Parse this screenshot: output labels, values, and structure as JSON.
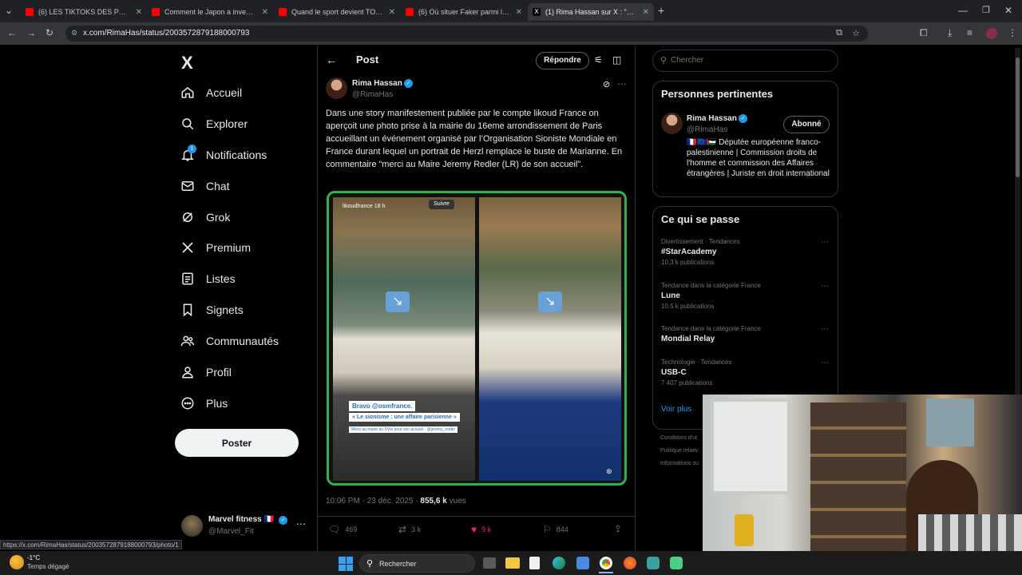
{
  "browser": {
    "tabs": [
      {
        "title": "(6) LES TIKTOKS DES POLITIQUES",
        "color": "#ff0000",
        "active": false
      },
      {
        "title": "Comment le Japon a inventé l'a",
        "color": "#ff0000",
        "active": false
      },
      {
        "title": "Quand le sport devient TOXIQUE",
        "color": "#ff0000",
        "active": false
      },
      {
        "title": "(6) Où situer Faker parmi les lég",
        "color": "#ff0000",
        "active": false
      },
      {
        "title": "(1) Rima Hassan sur X : \"Dans u",
        "color": "#ffffff",
        "active": true
      }
    ],
    "new_tab": "+",
    "url": "x.com/RimaHas/status/2003572879188000793",
    "status_url": "https://x.com/RimaHas/status/2003572879188000793/photo/1"
  },
  "nav": {
    "logo": "X",
    "items": [
      {
        "label": "Accueil",
        "icon": "home-icon"
      },
      {
        "label": "Explorer",
        "icon": "search-icon"
      },
      {
        "label": "Notifications",
        "icon": "bell-icon",
        "badge": "1"
      },
      {
        "label": "Chat",
        "icon": "mail-icon"
      },
      {
        "label": "Grok",
        "icon": "grok-icon"
      },
      {
        "label": "Premium",
        "icon": "x-premium-icon"
      },
      {
        "label": "Listes",
        "icon": "list-icon"
      },
      {
        "label": "Signets",
        "icon": "bookmark-icon"
      },
      {
        "label": "Communautés",
        "icon": "people-icon"
      },
      {
        "label": "Profil",
        "icon": "person-icon"
      },
      {
        "label": "Plus",
        "icon": "more-circle-icon"
      }
    ],
    "post_button": "Poster",
    "account": {
      "name": "Marvel fitness 🇫🇷",
      "handle": "@Marvel_Fit"
    }
  },
  "post_header": {
    "title": "Post",
    "reply_button": "Répondre"
  },
  "tweet": {
    "author": "Rima Hassan",
    "handle": "@RimaHas",
    "text": "Dans une story manifestement publiée par le compte likoud France on aperçoit une photo prise à la mairie du 16eme arrondissement de Paris accueillant un événement organisé par l’Organisation Sioniste Mondiale en France durant lequel un portrait de Herzl remplace le buste de Marianne. En commentaire “merci au Maire Jeremy Redler (LR) de son accueil”.",
    "image": {
      "account": "likoudfrance",
      "time": "18 h",
      "follow": "Suivre",
      "caption_line1": "Bravo @osmfrance.",
      "caption_line2": "« Le sionisme : une affaire parisienne »",
      "caption_line3": "Merci au maire du XVIe pour son accueil - @jeremy_redler"
    },
    "timestamp": "10:06 PM · 23 déc. 2025",
    "views_count": "855,6 k",
    "views_label": "vues",
    "stats": {
      "replies": "469",
      "retweets": "3 k",
      "likes": "9 k",
      "bookmarks": "844"
    }
  },
  "sidebar": {
    "search_placeholder": "Chercher",
    "relevant": {
      "title": "Personnes pertinentes",
      "name": "Rima Hassan",
      "handle": "@RimaHas",
      "button": "Abonné",
      "bio": "🇫🇷🇪🇺🇵🇸 Députée européenne franco-palestinienne | Commission droits de l'homme et commission des Affaires étrangères | Juriste en droit international"
    },
    "trends_title": "Ce qui se passe",
    "trends": [
      {
        "category": "Divertissement · Tendances",
        "name": "#StarAcademy",
        "count": "10,3 k publications"
      },
      {
        "category": "Tendance dans la catégorie France",
        "name": "Lune",
        "count": "10,5 k publications"
      },
      {
        "category": "Tendance dans la catégorie France",
        "name": "Mondial Relay",
        "count": ""
      },
      {
        "category": "Technologie · Tendances",
        "name": "USB-C",
        "count": "7 407 publications"
      }
    ],
    "see_more": "Voir plus",
    "footer": [
      "Conditions d'ut",
      "Politique relativ",
      "Informations su"
    ]
  },
  "taskbar": {
    "temp": "-1°C",
    "weather": "Temps dégagé",
    "search": "Rechercher"
  }
}
